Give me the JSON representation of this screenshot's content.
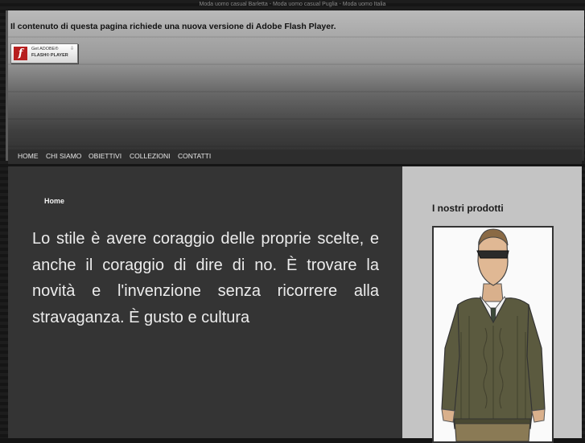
{
  "page": {
    "top_caption": "Moda uomo casual Barletta - Moda uomo casual Puglia - Moda uomo Italia"
  },
  "header": {
    "flash_message": "Il contenuto di questa pagina richiede una nuova versione di Adobe Flash Player.",
    "flash_badge": {
      "line1": "Get ADOBE®",
      "line2": "FLASH® PLAYER",
      "icon": "flash-player-icon"
    }
  },
  "nav": {
    "items": [
      {
        "label": "HOME"
      },
      {
        "label": "CHI SIAMO"
      },
      {
        "label": "OBIETTIVI"
      },
      {
        "label": "COLLEZIONI"
      },
      {
        "label": "CONTATTI"
      }
    ]
  },
  "main": {
    "breadcrumb": "Home",
    "quote": "Lo stile è avere coraggio delle proprie scelte, e anche il coraggio di dire di no. È trovare la novità e l'invenzione senza ricorrere alla stravaganza. È gusto e cultura"
  },
  "sidebar": {
    "title": "I nostri prodotti",
    "product_image": "fashion-sketch-man-in-sweater"
  },
  "colors": {
    "main_bg": "#343434",
    "sidebar_bg": "#c4c4c4",
    "nav_bg": "#2d2d2d",
    "flash_red": "#b71f1f"
  }
}
